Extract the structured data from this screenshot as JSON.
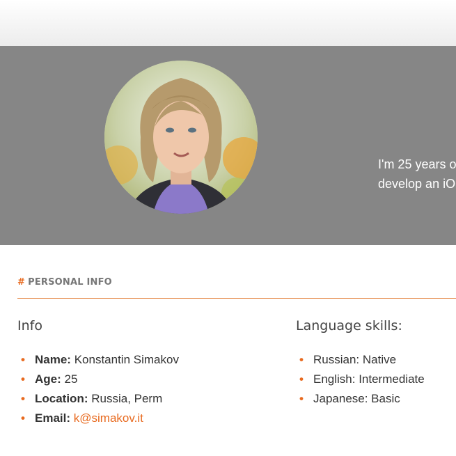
{
  "hero": {
    "intro_line_1": "I'm 25 years o",
    "intro_line_2": "develop an iO"
  },
  "section": {
    "hash": "#",
    "title": "PERSONAL INFO"
  },
  "info": {
    "heading": "Info",
    "items": [
      {
        "key": "Name:",
        "value": "Konstantin Simakov"
      },
      {
        "key": "Age:",
        "value": "25"
      },
      {
        "key": "Location:",
        "value": "Russia, Perm"
      },
      {
        "key": "Email:",
        "value": "k@simakov.it"
      }
    ]
  },
  "languages": {
    "heading": "Language skills:",
    "items": [
      "Russian: Native",
      "English: Intermediate",
      "Japanese: Basic"
    ]
  },
  "colors": {
    "accent": "#e86a1f",
    "hero_bg": "#868686"
  }
}
